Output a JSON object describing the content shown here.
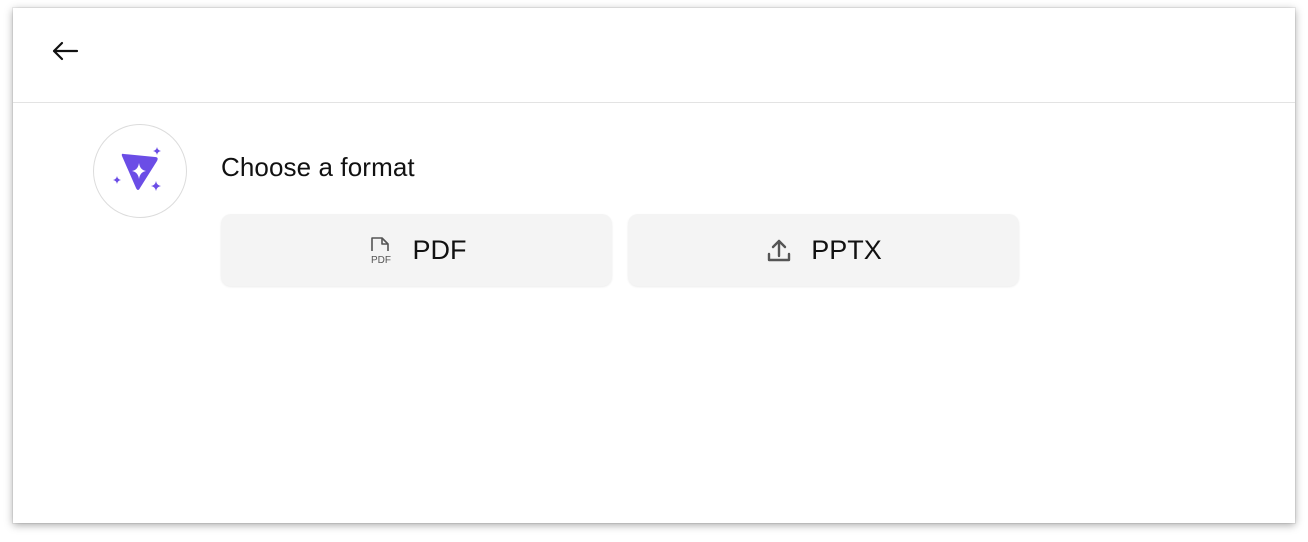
{
  "header": {
    "back_icon": "arrow-left-icon"
  },
  "assistant": {
    "avatar_icon": "sparkle-play-icon",
    "accent_color": "#6b4de6"
  },
  "main": {
    "title": "Choose a format",
    "formats": [
      {
        "label": "PDF",
        "icon": "pdf-file-icon",
        "icon_text": "PDF"
      },
      {
        "label": "PPTX",
        "icon": "upload-icon"
      }
    ]
  }
}
